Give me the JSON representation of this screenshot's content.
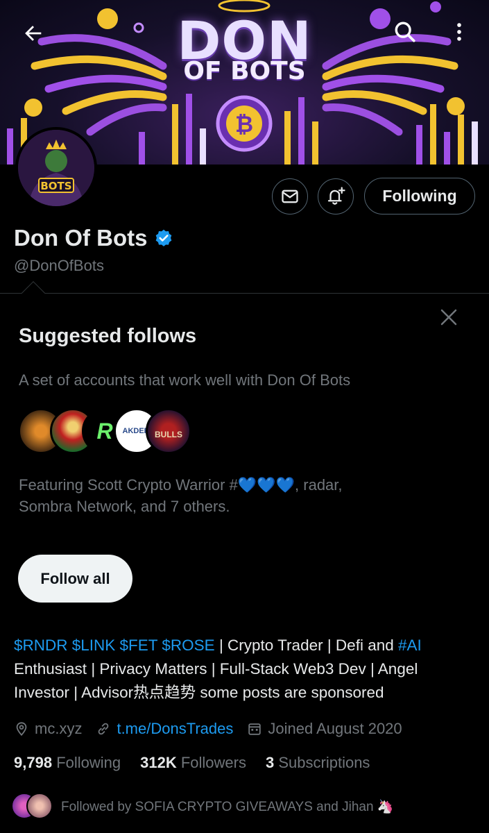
{
  "banner": {
    "title": "DON",
    "subtitle": "OF BOTS"
  },
  "header": {
    "back_icon": "arrow-left-icon",
    "search_icon": "search-icon",
    "more_icon": "more-vertical-icon"
  },
  "profile": {
    "name": "Don Of Bots",
    "handle": "@DonOfBots",
    "avatar_text": "BOTS",
    "verified_color": "#1d9bf0",
    "following_label": "Following"
  },
  "suggested": {
    "title": "Suggested follows",
    "subtitle": "A set of accounts that work well with Don Of Bots",
    "featuring_prefix": "Featuring Scott Crypto Warrior #",
    "featuring_hearts": "💙💙💙",
    "featuring_line1_end": ", radar,",
    "featuring_line2": "Sombra Network, and 7 others.",
    "follow_all_label": "Follow all",
    "face_labels": [
      "",
      "",
      "R",
      "AKDEFI",
      "BULLS"
    ]
  },
  "bio": {
    "tickers": "$RNDR $LINK $FET $ROSE",
    "part1": " | Crypto Trader | Defi and ",
    "ai_tag": "#AI",
    "line2": "Enthusiast | Privacy Matters | Full-Stack Web3 Dev | Angel",
    "line3": "Investor | Advisor热点趋势 some posts are sponsored"
  },
  "meta": {
    "location": "mc.xyz",
    "link": "t.me/DonsTrades",
    "joined": "Joined August 2020"
  },
  "stats": {
    "following_count": "9,798",
    "following_label": "Following",
    "followers_count": "312K",
    "followers_label": "Followers",
    "subs_count": "3",
    "subs_label": "Subscriptions"
  },
  "followed_by": "Followed by SOFIA CRYPTO GIVEAWAYS and Jihan 🦄",
  "colors": {
    "accent": "#1d9bf0",
    "background": "#000000",
    "muted": "#71767b",
    "border": "#2f3336"
  }
}
